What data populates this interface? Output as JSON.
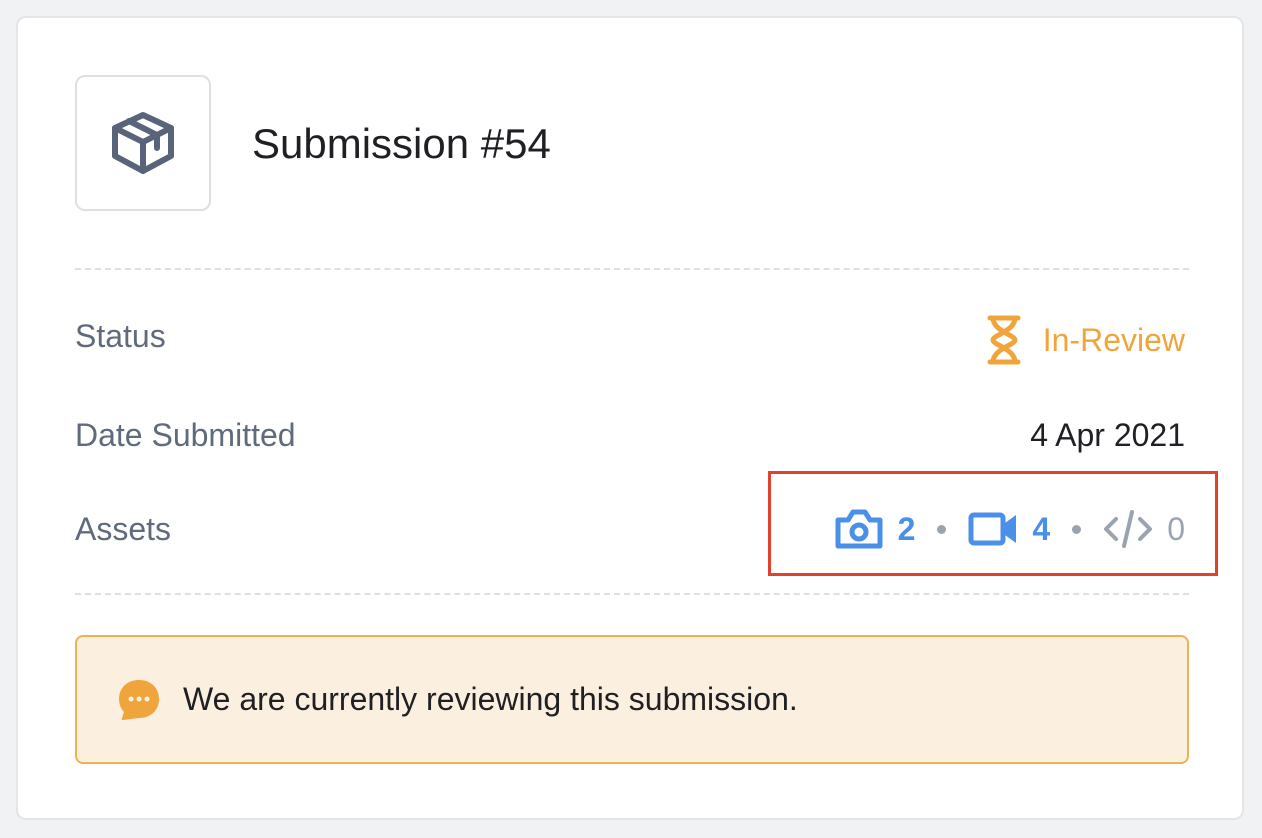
{
  "submission": {
    "title": "Submission #54",
    "icon": "package-icon"
  },
  "details": {
    "status_label": "Status",
    "status_value": "In-Review",
    "status_icon": "hourglass-icon",
    "date_label": "Date Submitted",
    "date_value": "4 Apr 2021",
    "assets_label": "Assets",
    "assets": [
      {
        "icon": "camera-icon",
        "count": "2"
      },
      {
        "icon": "video-icon",
        "count": "4"
      },
      {
        "icon": "code-icon",
        "count": "0"
      }
    ]
  },
  "notice": {
    "icon": "chat-bubble-icon",
    "message": "We are currently reviewing this submission."
  },
  "colors": {
    "accent_blue": "#4a8fe8",
    "status_orange": "#f0a53c",
    "notice_bg": "#fbefe0",
    "highlight_red": "#e2412e"
  }
}
